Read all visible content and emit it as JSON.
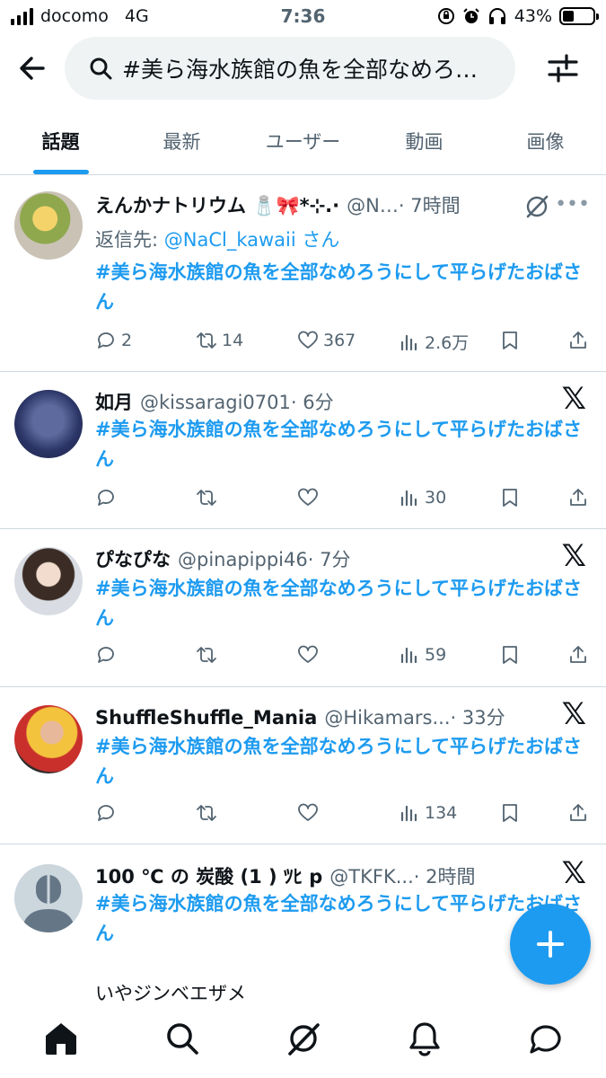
{
  "status_bar": {
    "carrier": "docomo",
    "network": "4G",
    "time": "7:36",
    "battery": "43%"
  },
  "search": {
    "query": "#美ら海水族館の魚を全部なめろうにして平らげたおばさん"
  },
  "tabs": [
    {
      "label": "話題",
      "active": true
    },
    {
      "label": "最新",
      "active": false
    },
    {
      "label": "ユーザー",
      "active": false
    },
    {
      "label": "動画",
      "active": false
    },
    {
      "label": "画像",
      "active": false
    }
  ],
  "tweets": [
    {
      "name": "えんかナトリウム 🧂🎀*⊹.·",
      "handle": "@N…",
      "time": "· 7時間",
      "reply_prefix": "返信先: ",
      "reply_to": "@NaCl_kawaii",
      "reply_suffix": " さん",
      "text": "#美ら海水族館の魚を全部なめろうにして平らげたおばさん",
      "replies": "2",
      "retweets": "14",
      "likes": "367",
      "views": "2.6万"
    },
    {
      "name": "如月",
      "handle": "@kissaragi0701",
      "time": "· 6分",
      "text": "#美ら海水族館の魚を全部なめろうにして平らげたおばさん",
      "replies": "",
      "retweets": "",
      "likes": "",
      "views": "30"
    },
    {
      "name": "ぴなぴな",
      "handle": "@pinapippi46",
      "time": "· 7分",
      "text": "#美ら海水族館の魚を全部なめろうにして平らげたおばさん",
      "replies": "",
      "retweets": "",
      "likes": "",
      "views": "59"
    },
    {
      "name": "ShuffleShuffle_Mania",
      "handle": "@Hikamars...",
      "time": "· 33分",
      "text": "#美ら海水族館の魚を全部なめろうにして平らげたおばさん",
      "replies": "",
      "retweets": "",
      "likes": "",
      "views": "134"
    },
    {
      "name": "100 ℃ の 炭酸 (1 ) ﾂﾋ p",
      "handle": "@TKFK...",
      "time": "· 2時間",
      "text": "#美ら海水族館の魚を全部なめろうにして平らげたおばさん",
      "extra_text": "いやジンベエザメ"
    }
  ],
  "icons": {
    "back": "arrow-left-icon",
    "search": "search-icon",
    "filter": "sliders-icon",
    "platform": "x-logo-icon",
    "compose": "plus-icon"
  },
  "colors": {
    "accent": "#1d9bf0",
    "text": "#0f1419",
    "muted": "#536471"
  }
}
